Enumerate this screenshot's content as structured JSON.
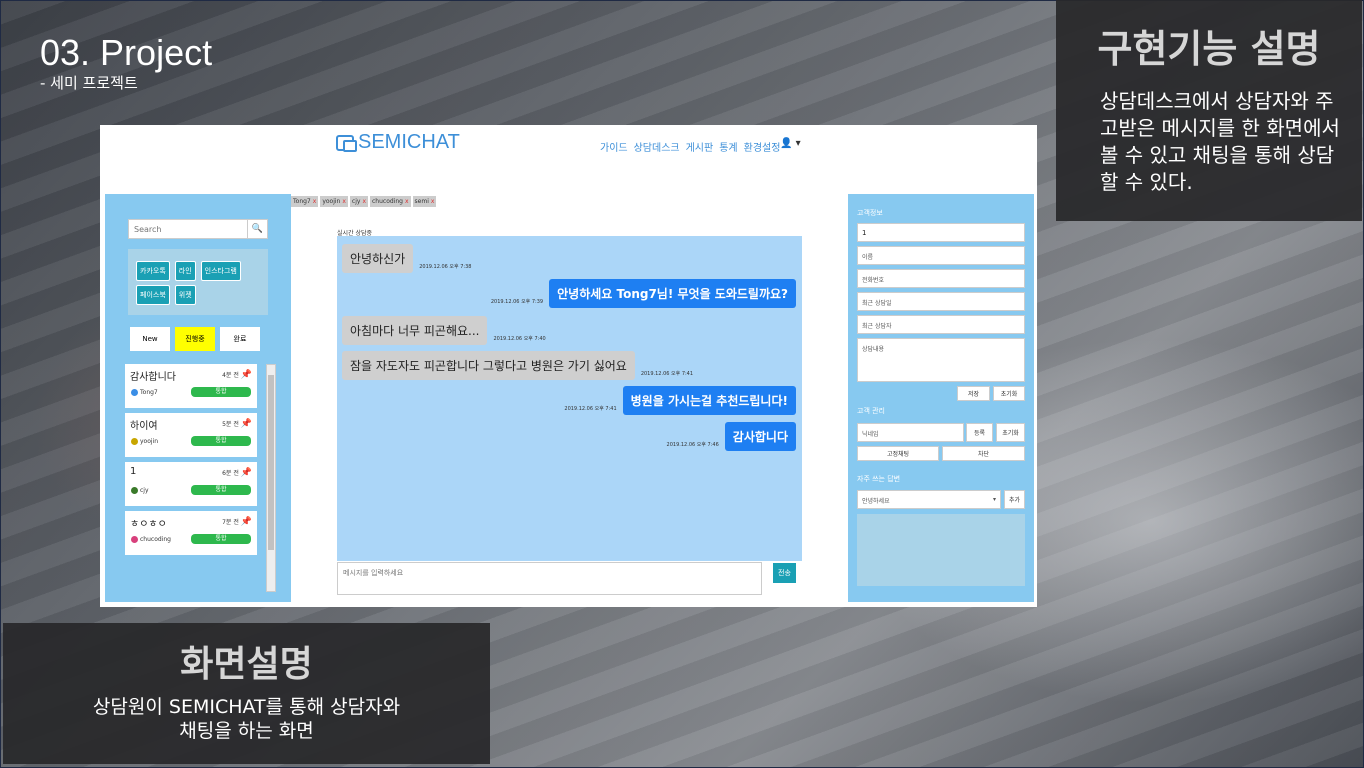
{
  "slide": {
    "title": "03. Project",
    "subtitle": "- 세미 프로젝트",
    "feature_title": "구현기능 설명",
    "feature_desc": "상담데스크에서 상담자와 주고받은 메시지를 한 화면에서 볼 수 있고 채팅을 통해 상담할 수 있다.",
    "screen_title": "화면설명",
    "screen_desc_line1": "상담원이 SEMICHAT를 통해 상담자와",
    "screen_desc_line2": "채팅을 하는 화면"
  },
  "app": {
    "logo": "SEMICHAT",
    "nav": [
      "가이드",
      "상담데스크",
      "게시판",
      "통계",
      "환경설정"
    ],
    "user_menu": "▾",
    "search_placeholder": "Search",
    "channels": [
      "카카오톡",
      "라인",
      "인스타그램",
      "페이스북",
      "위젯"
    ],
    "filters": [
      "New",
      "진행중",
      "완료"
    ],
    "conversations": [
      {
        "name": "감사합니다",
        "time": "4분 전",
        "user": "Tong7",
        "status": "통합"
      },
      {
        "name": "하이여",
        "time": "5분 전",
        "user": "yoojin",
        "status": "통합"
      },
      {
        "name": "1",
        "time": "6분 전",
        "user": "cjy",
        "status": "통합"
      },
      {
        "name": "ㅎㅇㅎㅇ",
        "time": "7분 전",
        "user": "chucoding",
        "status": "통합"
      }
    ],
    "tabs": [
      "Tong7",
      "yoojin",
      "cjy",
      "chucoding",
      "semi"
    ],
    "tab_close": "x",
    "chat_label": "실시간 상담중",
    "messages": [
      {
        "dir": "in",
        "text": "안녕하신가",
        "time": "2019.12.06 오후 7:38"
      },
      {
        "dir": "out",
        "text": "안녕하세요 Tong7님! 무엇을 도와드릴까요?",
        "time": "2019.12.06 오후 7:39"
      },
      {
        "dir": "in",
        "text": "아침마다 너무 피곤해요...",
        "time": "2019.12.06 오후 7:40"
      },
      {
        "dir": "in",
        "text": "잠을 자도자도 피곤합니다 그렇다고 병원은 가기 싫어요",
        "time": "2019.12.06 오후 7:41"
      },
      {
        "dir": "out",
        "text": "병원을 가시는걸 추천드립니다!",
        "time": "2019.12.06 오후 7:41"
      },
      {
        "dir": "out",
        "text": "감사합니다",
        "time": "2019.12.06 오후 7:46"
      }
    ],
    "message_placeholder": "메시지를 입력하세요",
    "send_label": "전송",
    "customer_info_title": "고객정보",
    "customer_id_value": "1",
    "field_name": "이름",
    "field_phone": "전화번호",
    "field_recent_date": "최근 상담일",
    "field_recent_agent": "최근 상담자",
    "field_content": "상담내용",
    "save_label": "저장",
    "reset_label": "초기화",
    "customer_manage_title": "고객 관리",
    "nickname_placeholder": "닉네임",
    "register_label": "등록",
    "reset_label2": "초기화",
    "pin_chat_label": "고정채팅",
    "block_label": "차단",
    "quick_reply_title": "자주 쓰는 답변",
    "quick_reply_selected": "안녕하세요",
    "add_label": "추가"
  }
}
